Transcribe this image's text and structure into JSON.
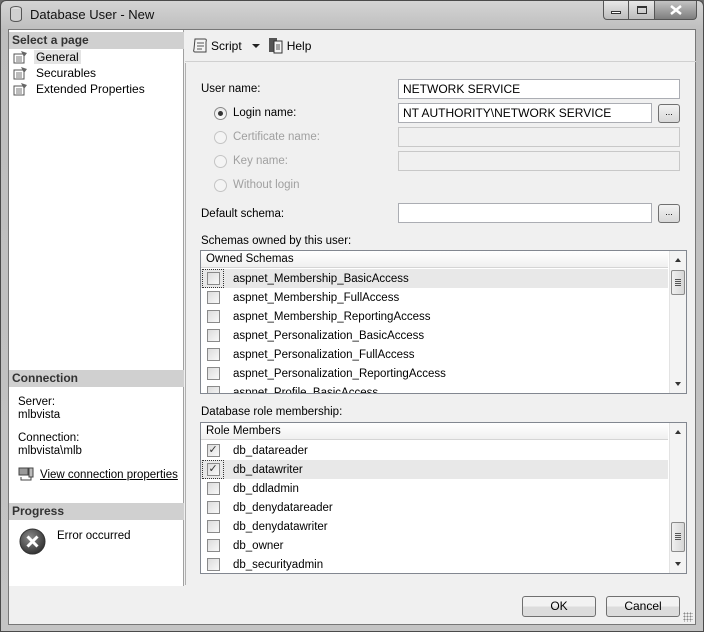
{
  "window": {
    "title": "Database User - New",
    "controls": {
      "minimize": "minimize",
      "maximize": "maximize",
      "close": "close"
    }
  },
  "left_pane": {
    "select_page_header": "Select a page",
    "pages": [
      {
        "label": "General",
        "selected": true
      },
      {
        "label": "Securables",
        "selected": false
      },
      {
        "label": "Extended Properties",
        "selected": false
      }
    ],
    "connection_header": "Connection",
    "server_label": "Server:",
    "server_value": "mlbvista",
    "connection_label": "Connection:",
    "connection_value": "mlbvista\\mlb",
    "view_connection_link": "View connection properties",
    "progress_header": "Progress",
    "progress_status": "Error occurred"
  },
  "toolbar": {
    "script_label": "Script",
    "help_label": "Help"
  },
  "form": {
    "user_name_label": "User name:",
    "user_name_value": "NETWORK SERVICE",
    "login_name_label": "Login name:",
    "login_name_value": "NT AUTHORITY\\NETWORK SERVICE",
    "certificate_name_label": "Certificate name:",
    "certificate_name_value": "",
    "key_name_label": "Key name:",
    "key_name_value": "",
    "without_login_label": "Without login",
    "selected_radio": "login_name",
    "default_schema_label": "Default schema:",
    "default_schema_value": "",
    "browse_label": "...",
    "schemas_owned_label": "Schemas owned by this user:",
    "owned_schemas": {
      "header": "Owned Schemas",
      "rows": [
        {
          "label": "aspnet_Membership_BasicAccess",
          "checked": false
        },
        {
          "label": "aspnet_Membership_FullAccess",
          "checked": false
        },
        {
          "label": "aspnet_Membership_ReportingAccess",
          "checked": false
        },
        {
          "label": "aspnet_Personalization_BasicAccess",
          "checked": false
        },
        {
          "label": "aspnet_Personalization_FullAccess",
          "checked": false
        },
        {
          "label": "aspnet_Personalization_ReportingAccess",
          "checked": false
        },
        {
          "label": "aspnet_Profile_BasicAccess",
          "checked": false
        }
      ]
    },
    "role_membership_label": "Database role membership:",
    "role_members": {
      "header": "Role Members",
      "rows": [
        {
          "label": "db_datareader",
          "checked": true
        },
        {
          "label": "db_datawriter",
          "checked": true
        },
        {
          "label": "db_ddladmin",
          "checked": false
        },
        {
          "label": "db_denydatareader",
          "checked": false
        },
        {
          "label": "db_denydatawriter",
          "checked": false
        },
        {
          "label": "db_owner",
          "checked": false
        },
        {
          "label": "db_securityadmin",
          "checked": false
        }
      ]
    }
  },
  "footer": {
    "ok_label": "OK",
    "cancel_label": "Cancel"
  }
}
